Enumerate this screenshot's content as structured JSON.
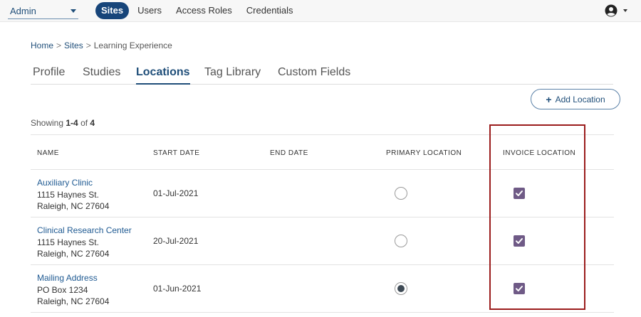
{
  "topbar": {
    "role_select": {
      "value": "Admin"
    },
    "nav": [
      {
        "label": "Sites",
        "active": true
      },
      {
        "label": "Users",
        "active": false
      },
      {
        "label": "Access Roles",
        "active": false
      },
      {
        "label": "Credentials",
        "active": false
      }
    ],
    "user_menu_icon": "account-circle-icon"
  },
  "breadcrumb": {
    "home": "Home",
    "sites": "Sites",
    "current": "Learning Experience",
    "separator": ">"
  },
  "tabs": [
    {
      "label": "Profile",
      "active": false
    },
    {
      "label": "Studies",
      "active": false
    },
    {
      "label": "Locations",
      "active": true
    },
    {
      "label": "Tag Library",
      "active": false
    },
    {
      "label": "Custom Fields",
      "active": false
    }
  ],
  "add_location": {
    "label": "Add Location",
    "icon": "+"
  },
  "showing": {
    "prefix": "Showing",
    "range": "1-4",
    "of": "of",
    "total": "4"
  },
  "table": {
    "headers": {
      "name": "NAME",
      "start_date": "START DATE",
      "end_date": "END DATE",
      "primary_location": "PRIMARY LOCATION",
      "invoice_location": "INVOICE LOCATION"
    },
    "rows": [
      {
        "name": "Auxiliary Clinic",
        "address1": "1115 Haynes St.",
        "address2": "Raleigh, NC 27604",
        "start_date": "01-Jul-2021",
        "end_date": "",
        "primary": false,
        "invoice": true
      },
      {
        "name": "Clinical Research Center",
        "address1": "1115 Haynes St.",
        "address2": "Raleigh, NC 27604",
        "start_date": "20-Jul-2021",
        "end_date": "",
        "primary": false,
        "invoice": true
      },
      {
        "name": "Mailing Address",
        "address1": "PO Box 1234",
        "address2": "Raleigh, NC 27604",
        "start_date": "01-Jun-2021",
        "end_date": "",
        "primary": true,
        "invoice": true
      }
    ]
  },
  "colors": {
    "brand": "#17457a",
    "link": "#1f5a92",
    "checkbox": "#6f5a86",
    "highlight": "#9b1c1c"
  }
}
